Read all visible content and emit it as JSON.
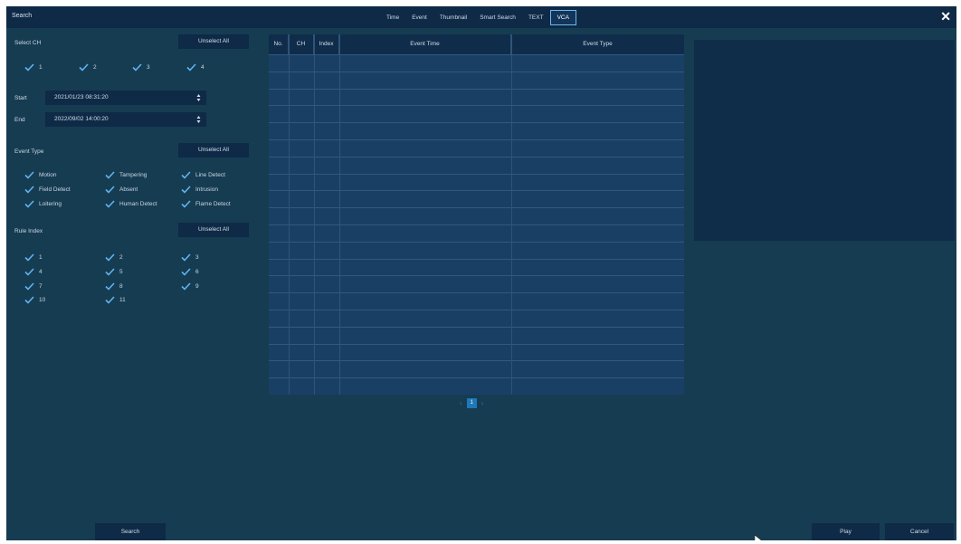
{
  "title": "Search",
  "tabs": [
    {
      "label": "Time",
      "active": false
    },
    {
      "label": "Event",
      "active": false
    },
    {
      "label": "Thumbnail",
      "active": false
    },
    {
      "label": "Smart Search",
      "active": false
    },
    {
      "label": "TEXT",
      "active": false
    },
    {
      "label": "VCA",
      "active": true
    }
  ],
  "close_icon": "close-icon",
  "select_ch": {
    "label": "Select CH",
    "unselect_label": "Unselect All",
    "channels": [
      {
        "label": "1",
        "checked": true
      },
      {
        "label": "2",
        "checked": true
      },
      {
        "label": "3",
        "checked": true
      },
      {
        "label": "4",
        "checked": true
      }
    ]
  },
  "datetime": {
    "start_label": "Start",
    "start_value": "2021/01/23 08:31:20",
    "end_label": "End",
    "end_value": "2022/09/02 14:00:20"
  },
  "event_type": {
    "label": "Event Type",
    "unselect_label": "Unselect All",
    "items": [
      {
        "label": "Motion",
        "checked": true
      },
      {
        "label": "Tampering",
        "checked": true
      },
      {
        "label": "Line Detect",
        "checked": true
      },
      {
        "label": "Field Detect",
        "checked": true
      },
      {
        "label": "Absent",
        "checked": true
      },
      {
        "label": "Intrusion",
        "checked": true
      },
      {
        "label": "Loitering",
        "checked": true
      },
      {
        "label": "Human Detect",
        "checked": true
      },
      {
        "label": "Flame Detect",
        "checked": true
      }
    ]
  },
  "rule_index": {
    "label": "Rule Index",
    "unselect_label": "Unselect All",
    "items": [
      {
        "label": "1",
        "checked": true
      },
      {
        "label": "2",
        "checked": true
      },
      {
        "label": "3",
        "checked": true
      },
      {
        "label": "4",
        "checked": true
      },
      {
        "label": "5",
        "checked": true
      },
      {
        "label": "6",
        "checked": true
      },
      {
        "label": "7",
        "checked": true
      },
      {
        "label": "8",
        "checked": true
      },
      {
        "label": "9",
        "checked": true
      },
      {
        "label": "10",
        "checked": true
      },
      {
        "label": "11",
        "checked": true
      }
    ]
  },
  "results_table": {
    "columns": [
      "No.",
      "CH",
      "Index",
      "Event Time",
      "Event Type"
    ],
    "rows": []
  },
  "pagination": {
    "current_page": "1"
  },
  "buttons": {
    "search_label": "Search",
    "play_label": "Play",
    "cancel_label": "Cancel"
  },
  "colors": {
    "background": "#163c52",
    "panel": "#0e2a47",
    "accent": "#1e78b8",
    "check": "#5fb3ef"
  }
}
